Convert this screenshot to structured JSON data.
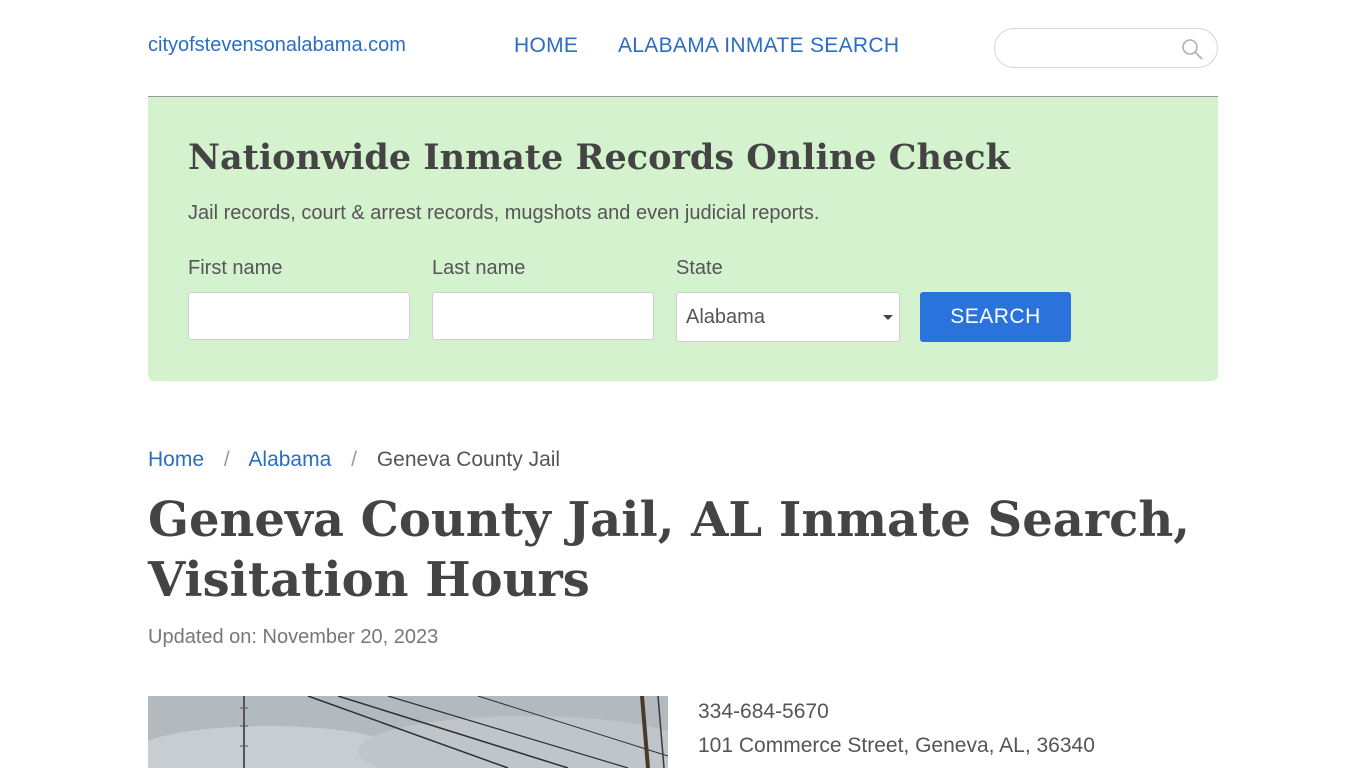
{
  "header": {
    "site_name": "cityofstevensonalabama.com",
    "nav": [
      "HOME",
      "ALABAMA INMATE SEARCH"
    ],
    "search_placeholder": "",
    "search_icon": "search-icon"
  },
  "hero": {
    "title": "Nationwide Inmate Records Online Check",
    "subtitle": "Jail records, court & arrest records, mugshots and even judicial reports.",
    "fields": {
      "first_name_label": "First name",
      "last_name_label": "Last name",
      "state_label": "State",
      "state_value": "Alabama"
    },
    "button_label": "SEARCH",
    "background_color": "#d5f2ce",
    "button_color": "#2b73dc"
  },
  "breadcrumb": [
    "Home",
    "Alabama",
    "Geneva County Jail"
  ],
  "page": {
    "title": "Geneva County Jail, AL Inmate Search, Visitation Hours",
    "updated": "Updated on: November 20, 2023"
  },
  "facility": {
    "phone": "334-684-5670",
    "address": "101 Commerce Street, Geneva, AL, 36340"
  },
  "colors": {
    "link": "#2b6cc4",
    "text": "#444444"
  }
}
